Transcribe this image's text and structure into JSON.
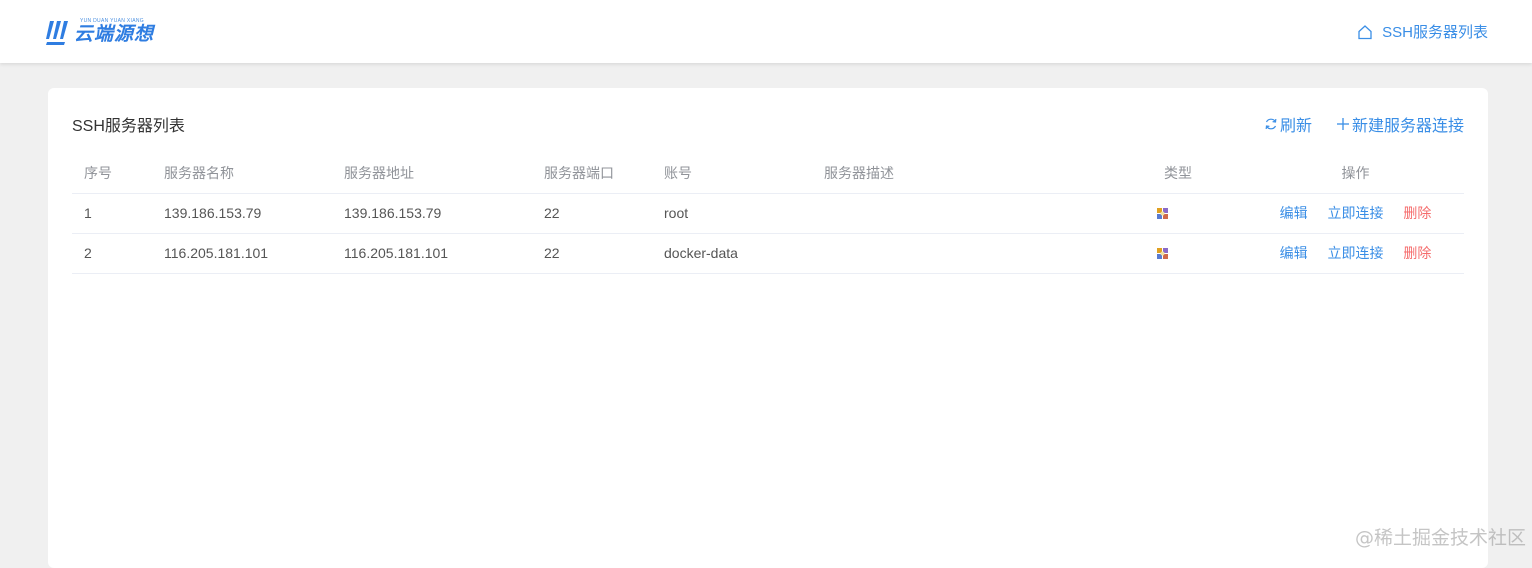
{
  "header": {
    "logo_text": "云端源想",
    "logo_subtext": "YUN DUAN YUAN XIANG",
    "nav_label": "SSH服务器列表",
    "nav_icon": "home-icon"
  },
  "card": {
    "title": "SSH服务器列表",
    "refresh_label": "刷新",
    "refresh_icon": "refresh-icon",
    "new_label": "新建服务器连接",
    "new_icon": "plus-icon"
  },
  "table": {
    "columns": [
      "序号",
      "服务器名称",
      "服务器地址",
      "服务器端口",
      "账号",
      "服务器描述",
      "类型",
      "操作"
    ],
    "rows": [
      {
        "index": "1",
        "name": "139.186.153.79",
        "address": "139.186.153.79",
        "port": "22",
        "account": "root",
        "description": "",
        "type_icon": "linux-icon",
        "edit": "编辑",
        "connect": "立即连接",
        "delete": "删除"
      },
      {
        "index": "2",
        "name": "116.205.181.101",
        "address": "116.205.181.101",
        "port": "22",
        "account": "docker-data",
        "description": "",
        "type_icon": "linux-icon",
        "edit": "编辑",
        "connect": "立即连接",
        "delete": "删除"
      }
    ]
  },
  "watermark": "@稀土掘金技术社区",
  "colors": {
    "accent": "#3a8ee6",
    "danger": "#f56c6c",
    "background": "#f0f0f0"
  }
}
